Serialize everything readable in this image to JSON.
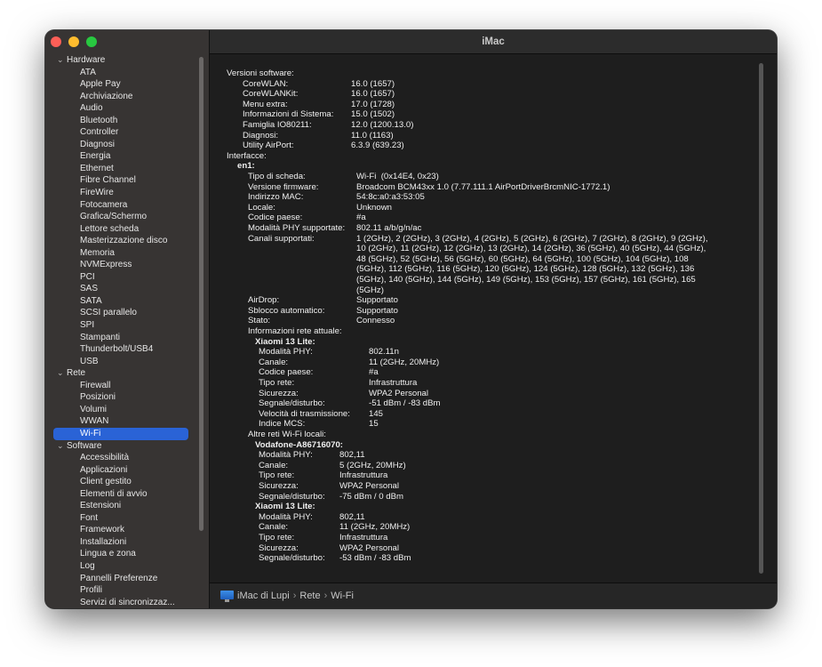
{
  "window": {
    "title": "iMac"
  },
  "sidebar": {
    "rows": [
      {
        "kind": "group",
        "label": "Hardware"
      },
      {
        "kind": "item",
        "label": "ATA"
      },
      {
        "kind": "item",
        "label": "Apple Pay"
      },
      {
        "kind": "item",
        "label": "Archiviazione"
      },
      {
        "kind": "item",
        "label": "Audio"
      },
      {
        "kind": "item",
        "label": "Bluetooth"
      },
      {
        "kind": "item",
        "label": "Controller"
      },
      {
        "kind": "item",
        "label": "Diagnosi"
      },
      {
        "kind": "item",
        "label": "Energia"
      },
      {
        "kind": "item",
        "label": "Ethernet"
      },
      {
        "kind": "item",
        "label": "Fibre Channel"
      },
      {
        "kind": "item",
        "label": "FireWire"
      },
      {
        "kind": "item",
        "label": "Fotocamera"
      },
      {
        "kind": "item",
        "label": "Grafica/Schermo"
      },
      {
        "kind": "item",
        "label": "Lettore scheda"
      },
      {
        "kind": "item",
        "label": "Masterizzazione disco"
      },
      {
        "kind": "item",
        "label": "Memoria"
      },
      {
        "kind": "item",
        "label": "NVMExpress"
      },
      {
        "kind": "item",
        "label": "PCI"
      },
      {
        "kind": "item",
        "label": "SAS"
      },
      {
        "kind": "item",
        "label": "SATA"
      },
      {
        "kind": "item",
        "label": "SCSI parallelo"
      },
      {
        "kind": "item",
        "label": "SPI"
      },
      {
        "kind": "item",
        "label": "Stampanti"
      },
      {
        "kind": "item",
        "label": "Thunderbolt/USB4"
      },
      {
        "kind": "item",
        "label": "USB"
      },
      {
        "kind": "group",
        "label": "Rete"
      },
      {
        "kind": "item",
        "label": "Firewall"
      },
      {
        "kind": "item",
        "label": "Posizioni"
      },
      {
        "kind": "item",
        "label": "Volumi"
      },
      {
        "kind": "item",
        "label": "WWAN"
      },
      {
        "kind": "item",
        "label": "Wi-Fi",
        "selected": true
      },
      {
        "kind": "group",
        "label": "Software"
      },
      {
        "kind": "item",
        "label": "Accessibilità"
      },
      {
        "kind": "item",
        "label": "Applicazioni"
      },
      {
        "kind": "item",
        "label": "Client gestito"
      },
      {
        "kind": "item",
        "label": "Elementi di avvio"
      },
      {
        "kind": "item",
        "label": "Estensioni"
      },
      {
        "kind": "item",
        "label": "Font"
      },
      {
        "kind": "item",
        "label": "Framework"
      },
      {
        "kind": "item",
        "label": "Installazioni"
      },
      {
        "kind": "item",
        "label": "Lingua e zona"
      },
      {
        "kind": "item",
        "label": "Log"
      },
      {
        "kind": "item",
        "label": "Pannelli Preferenze"
      },
      {
        "kind": "item",
        "label": "Profili"
      },
      {
        "kind": "item",
        "label": "Servizi di sincronizzaz..."
      }
    ]
  },
  "details": [
    {
      "indent": 0,
      "label": "Versioni software:"
    },
    {
      "indent": 1,
      "label": "CoreWLAN:",
      "value": "16.0 (1657)",
      "col": 1
    },
    {
      "indent": 1,
      "label": "CoreWLANKit:",
      "value": "16.0 (1657)",
      "col": 1
    },
    {
      "indent": 1,
      "label": "Menu extra:",
      "value": "17.0 (1728)",
      "col": 1
    },
    {
      "indent": 1,
      "label": "Informazioni di Sistema:",
      "value": "15.0 (1502)",
      "col": 1
    },
    {
      "indent": 1,
      "label": "Famiglia IO80211:",
      "value": "12.0 (1200.13.0)",
      "col": 1
    },
    {
      "indent": 1,
      "label": "Diagnosi:",
      "value": "11.0 (1163)",
      "col": 1
    },
    {
      "indent": 1,
      "label": "Utility AirPort:",
      "value": "6.3.9 (639.23)",
      "col": 1
    },
    {
      "indent": 0,
      "label": "Interfacce:"
    },
    {
      "indent": 1,
      "label": "en1:",
      "bold": true,
      "x": 2
    },
    {
      "indent": 2,
      "label": "Tipo di scheda:",
      "value": "Wi-Fi  (0x14E4, 0x23)",
      "col": 2
    },
    {
      "indent": 2,
      "label": "Versione firmware:",
      "value": "Broadcom BCM43xx 1.0 (7.77.111.1 AirPortDriverBrcmNIC-1772.1)",
      "col": 2
    },
    {
      "indent": 2,
      "label": "Indirizzo MAC:",
      "value": "54:8c:a0:a3:53:05",
      "col": 2
    },
    {
      "indent": 2,
      "label": "Locale:",
      "value": "Unknown",
      "col": 2
    },
    {
      "indent": 2,
      "label": "Codice paese:",
      "value": "#a",
      "col": 2
    },
    {
      "indent": 2,
      "label": "Modalità PHY supportate:",
      "value": "802.11 a/b/g/n/ac",
      "col": 2
    },
    {
      "indent": 2,
      "label": "Canali supportati:",
      "value": "1 (2GHz), 2 (2GHz), 3 (2GHz), 4 (2GHz), 5 (2GHz), 6 (2GHz), 7 (2GHz), 8 (2GHz), 9 (2GHz),",
      "col": 2
    },
    {
      "indent": 2,
      "value": "10 (2GHz), 11 (2GHz), 12 (2GHz), 13 (2GHz), 14 (2GHz), 36 (5GHz), 40 (5GHz), 44 (5GHz),",
      "col": 2
    },
    {
      "indent": 2,
      "value": "48 (5GHz), 52 (5GHz), 56 (5GHz), 60 (5GHz), 64 (5GHz), 100 (5GHz), 104 (5GHz), 108",
      "col": 2
    },
    {
      "indent": 2,
      "value": "(5GHz), 112 (5GHz), 116 (5GHz), 120 (5GHz), 124 (5GHz), 128 (5GHz), 132 (5GHz), 136",
      "col": 2
    },
    {
      "indent": 2,
      "value": "(5GHz), 140 (5GHz), 144 (5GHz), 149 (5GHz), 153 (5GHz), 157 (5GHz), 161 (5GHz), 165",
      "col": 2
    },
    {
      "indent": 2,
      "value": "(5GHz)",
      "col": 2
    },
    {
      "indent": 2,
      "label": "AirDrop:",
      "value": "Supportato",
      "col": 2
    },
    {
      "indent": 2,
      "label": "Sblocco automatico:",
      "value": "Supportato",
      "col": 2
    },
    {
      "indent": 2,
      "label": "Stato:",
      "value": "Connesso",
      "col": 2
    },
    {
      "indent": 2,
      "label": "Informazioni rete attuale:"
    },
    {
      "indent": 3,
      "label": "Xiaomi 13 Lite:",
      "bold": true
    },
    {
      "indent": 4,
      "label": "Modalità PHY:",
      "value": "802.11n",
      "col": 3
    },
    {
      "indent": 4,
      "label": "Canale:",
      "value": "11 (2GHz, 20MHz)",
      "col": 3
    },
    {
      "indent": 4,
      "label": "Codice paese:",
      "value": "#a",
      "col": 3
    },
    {
      "indent": 4,
      "label": "Tipo rete:",
      "value": "Infrastruttura",
      "col": 3
    },
    {
      "indent": 4,
      "label": "Sicurezza:",
      "value": "WPA2 Personal",
      "col": 3
    },
    {
      "indent": 4,
      "label": "Segnale/disturbo:",
      "value": "-51 dBm / -83 dBm",
      "col": 3
    },
    {
      "indent": 4,
      "label": "Velocità di trasmissione:",
      "value": "145",
      "col": 3
    },
    {
      "indent": 4,
      "label": "Indice MCS:",
      "value": "15",
      "col": 3
    },
    {
      "indent": 2,
      "label": "Altre reti Wi-Fi locali:"
    },
    {
      "indent": 3,
      "label": "Vodafone-A86716070:",
      "bold": true
    },
    {
      "indent": 4,
      "label": "Modalità PHY:",
      "value": "802,11",
      "col": 4
    },
    {
      "indent": 4,
      "label": "Canale:",
      "value": "5 (2GHz, 20MHz)",
      "col": 4
    },
    {
      "indent": 4,
      "label": "Tipo rete:",
      "value": "Infrastruttura",
      "col": 4
    },
    {
      "indent": 4,
      "label": "Sicurezza:",
      "value": "WPA2 Personal",
      "col": 4
    },
    {
      "indent": 4,
      "label": "Segnale/disturbo:",
      "value": "-75 dBm / 0 dBm",
      "col": 4
    },
    {
      "indent": 3,
      "label": "Xiaomi 13 Lite:",
      "bold": true
    },
    {
      "indent": 4,
      "label": "Modalità PHY:",
      "value": "802,11",
      "col": 4
    },
    {
      "indent": 4,
      "label": "Canale:",
      "value": "11 (2GHz, 20MHz)",
      "col": 4
    },
    {
      "indent": 4,
      "label": "Tipo rete:",
      "value": "Infrastruttura",
      "col": 4
    },
    {
      "indent": 4,
      "label": "Sicurezza:",
      "value": "WPA2 Personal",
      "col": 4
    },
    {
      "indent": 4,
      "label": "Segnale/disturbo:",
      "value": "-53 dBm / -83 dBm",
      "col": 4
    }
  ],
  "pathbar": {
    "segments": [
      "iMac di Lupi",
      "Rete",
      "Wi-Fi"
    ],
    "separator": "›"
  }
}
